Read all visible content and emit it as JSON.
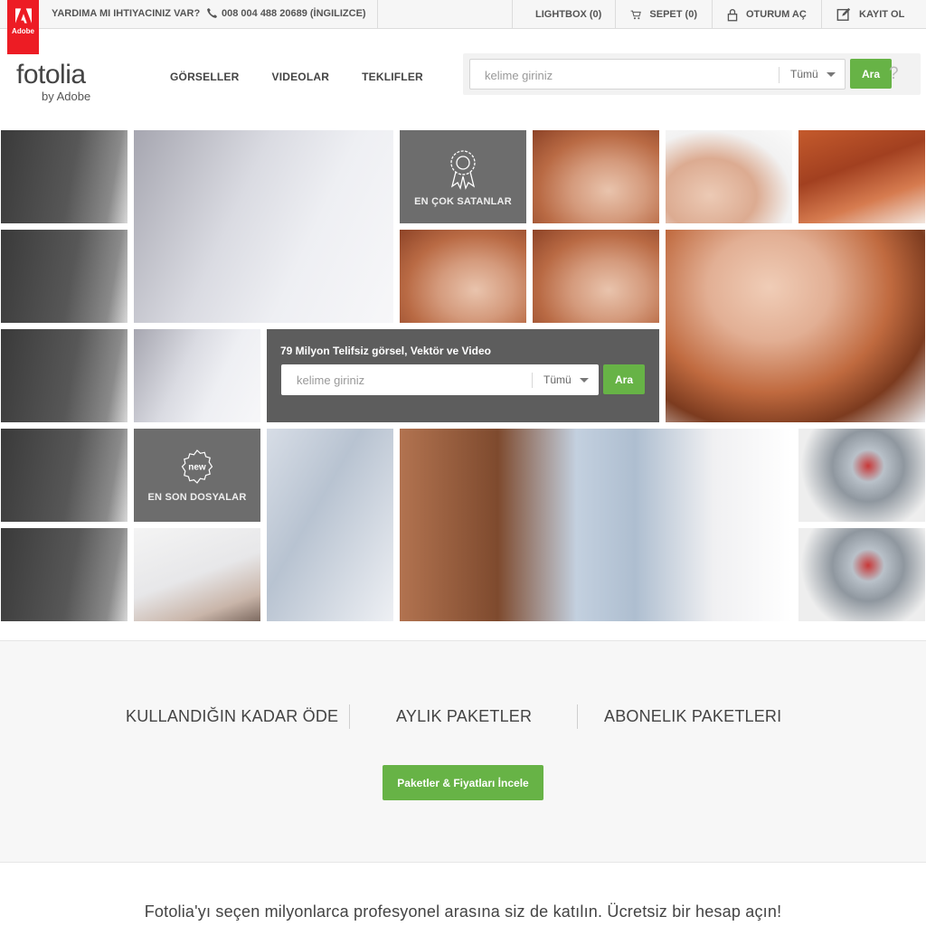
{
  "brand": {
    "adobe_logo_text": "Adobe",
    "name": "fotolia",
    "sub": "by Adobe"
  },
  "topbar": {
    "help": "YARDIMA MI IHTIYACINIZ VAR?",
    "phone": "008 004 488 20689 (İNGILIZCE)",
    "links": {
      "lightbox": "LIGHTBOX (0)",
      "cart": "SEPET (0)",
      "login": "OTURUM AÇ",
      "register": "KAYIT OL"
    }
  },
  "nav": {
    "images": "GÖRSELLER",
    "videos": "VIDEOLAR",
    "offers": "TEKLIFLER"
  },
  "header_search": {
    "placeholder": "kelime giriniz",
    "category": "Tümü",
    "button": "Ara",
    "help": "?"
  },
  "mosaic": {
    "bestsellers": "EN ÇOK SATANLAR",
    "newest": "EN SON DOSYALAR",
    "new_badge": "new",
    "promo_title": "79 Milyon Telifsiz görsel, Vektör ve Video",
    "promo_search": {
      "placeholder": "kelime giriniz",
      "category": "Tümü",
      "button": "Ara"
    }
  },
  "pricing": {
    "pay_as_you_go": "KULLANDIĞIN KADAR ÖDE",
    "monthly": "AYLIK PAKETLER",
    "subscription": "ABONELIK PAKETLERI",
    "cta": "Paketler & Fiyatları İncele"
  },
  "join_text": "Fotolia'yı seçen milyonlarca profesyonel arasına siz de katılın. Ücretsiz bir hesap açın!",
  "colors": {
    "adobe_red": "#ed1c24",
    "accent_green": "#67b346",
    "tile_grey": "#6d6d6d",
    "promo_grey": "#5d5d5d"
  }
}
